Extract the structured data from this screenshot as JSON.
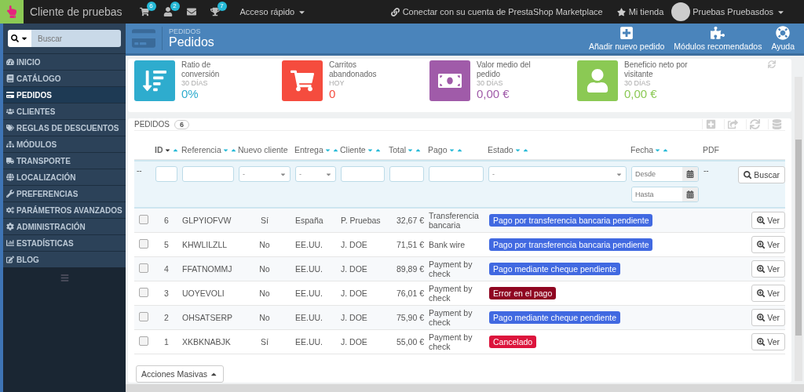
{
  "topbar": {
    "shop_name": "Cliente de pruebas",
    "notifications": [
      {
        "kind": "cart",
        "count": "6"
      },
      {
        "kind": "user",
        "count": "2"
      },
      {
        "kind": "mail"
      },
      {
        "kind": "trophy",
        "count": "7"
      }
    ],
    "quick_access": "Acceso rápido",
    "marketplace_link": "Conectar con su cuenta de PrestaShop Marketplace",
    "shop_link": "Mi tienda",
    "user_name": "Pruebas Pruebasdos"
  },
  "sidebar": {
    "search_placeholder": "Buscar",
    "items": [
      {
        "label": "INICIO",
        "kind": "dashboard",
        "selected": false
      },
      {
        "label": "CATÁLOGO",
        "kind": "book",
        "selected": false
      },
      {
        "label": "PEDIDOS",
        "kind": "card",
        "selected": true
      },
      {
        "label": "CLIENTES",
        "kind": "users",
        "selected": false
      },
      {
        "label": "REGLAS DE DESCUENTOS",
        "kind": "tags",
        "selected": false
      },
      {
        "label": "MÓDULOS",
        "kind": "modules",
        "selected": false
      },
      {
        "label": "TRANSPORTE",
        "kind": "truck",
        "selected": false
      },
      {
        "label": "LOCALIZACIÓN",
        "kind": "globe",
        "selected": false
      },
      {
        "label": "PREFERENCIAS",
        "kind": "wrench",
        "selected": false
      },
      {
        "label": "PARÁMETROS AVANZADOS",
        "kind": "cogs",
        "selected": false
      },
      {
        "label": "ADMINISTRACIÓN",
        "kind": "cog",
        "selected": false
      },
      {
        "label": "ESTADÍSTICAS",
        "kind": "chart",
        "selected": false
      },
      {
        "label": "BLOG",
        "kind": "edit",
        "selected": false
      }
    ]
  },
  "header": {
    "breadcrumb": "PEDIDOS",
    "title": "Pedidos",
    "actions": [
      {
        "label": "Añadir nuevo pedido",
        "kind": "add"
      },
      {
        "label": "Módulos recomendados",
        "kind": "puzzle"
      },
      {
        "label": "Ayuda",
        "kind": "help"
      }
    ]
  },
  "kpis": [
    {
      "kind": "conversion",
      "title": "Ratio de conversión",
      "period": "30 DÍAS",
      "value": "0%",
      "color": "#2eacce"
    },
    {
      "kind": "cart",
      "title": "Carritos abandonados",
      "period": "HOY",
      "value": "0",
      "color": "#f54c3e"
    },
    {
      "kind": "money",
      "title": "Valor medio del pedido",
      "period": "30 DÍAS",
      "value": "0,00 €",
      "color": "#a05ba9"
    },
    {
      "kind": "visitor",
      "title": "Beneficio neto por visitante",
      "period": "30 DÍAS",
      "value": "0,00 €",
      "color": "#8bc954"
    }
  ],
  "orders": {
    "title": "PEDIDOS",
    "count": "6",
    "columns": [
      {
        "label": "ID",
        "sortable": true,
        "active_sort": true
      },
      {
        "label": "Referencia",
        "sortable": true,
        "active_sort": false
      },
      {
        "label": "Nuevo cliente",
        "sortable": false,
        "active_sort": false
      },
      {
        "label": "Entrega",
        "sortable": true,
        "active_sort": false
      },
      {
        "label": "Cliente",
        "sortable": true,
        "active_sort": false
      },
      {
        "label": "Total",
        "sortable": true,
        "active_sort": false
      },
      {
        "label": "Pago",
        "sortable": true,
        "active_sort": false
      },
      {
        "label": "Estado",
        "sortable": true,
        "active_sort": false
      },
      {
        "label": "Fecha",
        "sortable": true,
        "active_sort": false
      },
      {
        "label": "PDF",
        "sortable": false,
        "active_sort": false
      }
    ],
    "filters": [
      {
        "kind": "dash",
        "text": "--"
      },
      {
        "kind": "text"
      },
      {
        "kind": "text"
      },
      {
        "kind": "select",
        "value": "-"
      },
      {
        "kind": "select",
        "value": "-"
      },
      {
        "kind": "text"
      },
      {
        "kind": "text"
      },
      {
        "kind": "text"
      },
      {
        "kind": "select",
        "value": "-"
      },
      {
        "kind": "date",
        "from_placeholder": "Desde",
        "to_placeholder": "Hasta"
      },
      {
        "kind": "dash",
        "text": "--"
      },
      {
        "kind": "button",
        "label": "Buscar"
      }
    ],
    "rows": [
      {
        "checked": false,
        "cells": [
          "6",
          "GLPYIOFVW",
          "Sí",
          "España",
          "P. Pruebas",
          "32,67 €",
          "Transferencia bancaria"
        ],
        "status": {
          "label": "Pago por transferencia bancaria pendiente",
          "color": "#4169e1"
        },
        "action": "Ver"
      },
      {
        "checked": false,
        "cells": [
          "5",
          "KHWLILZLL",
          "No",
          "EE.UU.",
          "J. DOE",
          "71,51 €",
          "Bank wire"
        ],
        "status": {
          "label": "Pago por transferencia bancaria pendiente",
          "color": "#4169e1"
        },
        "action": "Ver"
      },
      {
        "checked": false,
        "cells": [
          "4",
          "FFATNOMMJ",
          "No",
          "EE.UU.",
          "J. DOE",
          "89,89 €",
          "Payment by check"
        ],
        "status": {
          "label": "Pago mediante cheque pendiente",
          "color": "#4169e1"
        },
        "action": "Ver"
      },
      {
        "checked": false,
        "cells": [
          "3",
          "UOYEVOLI",
          "No",
          "EE.UU.",
          "J. DOE",
          "76,01 €",
          "Payment by check"
        ],
        "status": {
          "label": "Error en el pago",
          "color": "#8f0621"
        },
        "action": "Ver"
      },
      {
        "checked": false,
        "cells": [
          "2",
          "OHSATSERP",
          "No",
          "EE.UU.",
          "J. DOE",
          "75,90 €",
          "Payment by check"
        ],
        "status": {
          "label": "Pago mediante cheque pendiente",
          "color": "#4169e1"
        },
        "action": "Ver"
      },
      {
        "checked": false,
        "cells": [
          "1",
          "XKBKNABJK",
          "Sí",
          "EE.UU.",
          "J. DOE",
          "55,00 €",
          "Payment by check"
        ],
        "status": {
          "label": "Cancelado",
          "color": "#dc143c"
        },
        "action": "Ver"
      }
    ],
    "bulk_actions": "Acciones Masivas"
  }
}
